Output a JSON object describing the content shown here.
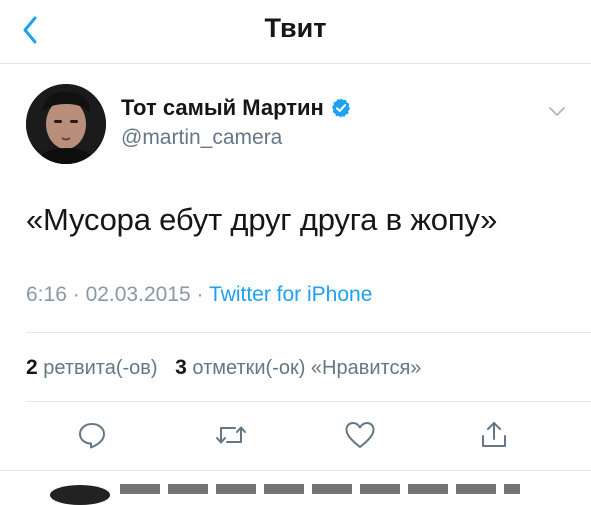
{
  "nav": {
    "title": "Твит",
    "back_icon": "chevron-left-icon"
  },
  "tweet": {
    "author_name": "Тот самый Мартин",
    "handle": "@martin_camera",
    "verified": true,
    "text": "«Мусора ебут друг друга в жопу»",
    "time": "6:16",
    "sep1": "·",
    "date": "02.03.2015",
    "sep2": "·",
    "source": "Twitter for iPhone"
  },
  "stats": {
    "retweets_count": "2",
    "retweets_label": "ретвита(-ов)",
    "likes_count": "3",
    "likes_label": "отметки(-ок) «Нравится»"
  },
  "actions": [
    "reply-icon",
    "retweet-icon",
    "like-icon",
    "share-icon"
  ],
  "colors": {
    "accent": "#1da1f2",
    "secondary_text": "#657786",
    "icon_gray": "#657786",
    "divider": "#e1e8ed"
  }
}
